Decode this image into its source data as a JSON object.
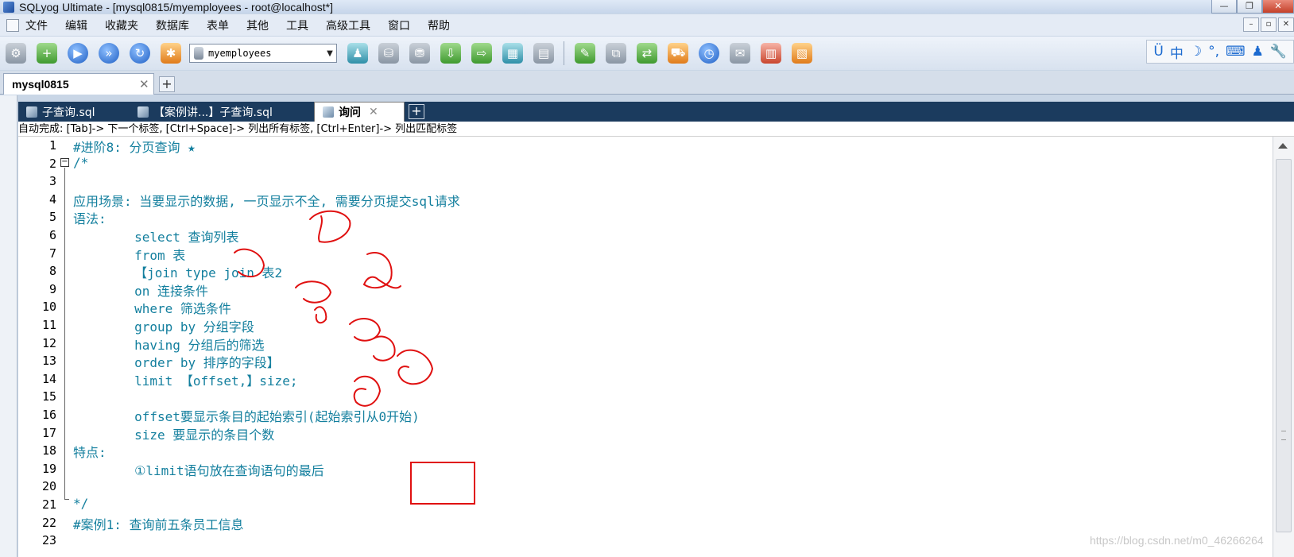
{
  "window": {
    "title": "SQLyog Ultimate - [mysql0815/myemployees - root@localhost*]",
    "buttons": [
      "—",
      "❐",
      "✕"
    ]
  },
  "menubar": {
    "items": [
      "文件",
      "编辑",
      "收藏夹",
      "数据库",
      "表单",
      "其他",
      "工具",
      "高级工具",
      "窗口",
      "帮助"
    ],
    "mdi_buttons": [
      "–",
      "▫",
      "✕"
    ]
  },
  "toolbar": {
    "database_selector": "myemployees",
    "icons": [
      "connect-icon",
      "new-connection-icon",
      "execute-query-icon",
      "execute-all-icon",
      "refresh-icon",
      "object-browser-icon",
      "user-manager-icon",
      "backup-icon",
      "restore-icon",
      "import-icon",
      "export-icon",
      "table-data-icon",
      "schema-designer-icon",
      "query-builder-icon",
      "copy-database-icon",
      "sync-icon",
      "migration-icon",
      "scheduler-icon",
      "notifications-icon",
      "sql-formatter-icon",
      "history-icon"
    ],
    "ime_items": [
      "Ü",
      "中",
      "☽",
      "°,",
      "⌨",
      "♟",
      "🔧"
    ]
  },
  "connection_tab": {
    "label": "mysql0815",
    "close": "✕",
    "add": "+"
  },
  "editor_tabs": [
    {
      "label": "子查询.sql",
      "active": false
    },
    {
      "label": "【案例讲...】子查询.sql",
      "active": false
    },
    {
      "label": "询问",
      "active": true
    }
  ],
  "editor_tab_close": "✕",
  "editor_tab_add": "+",
  "autocomplete_hint": "自动完成: [Tab]-> 下一个标签, [Ctrl+Space]-> 列出所有标签, [Ctrl+Enter]-> 列出匹配标签",
  "code_lines": [
    {
      "n": "1",
      "text": "#进阶8: 分页查询 ★"
    },
    {
      "n": "2",
      "text": "/*"
    },
    {
      "n": "3",
      "text": ""
    },
    {
      "n": "4",
      "text": "应用场景: 当要显示的数据, 一页显示不全, 需要分页提交sql请求"
    },
    {
      "n": "5",
      "text": "语法:"
    },
    {
      "n": "6",
      "text": "        select 查询列表"
    },
    {
      "n": "7",
      "text": "        from 表"
    },
    {
      "n": "8",
      "text": "        【join type join 表2"
    },
    {
      "n": "9",
      "text": "        on 连接条件"
    },
    {
      "n": "10",
      "text": "        where 筛选条件"
    },
    {
      "n": "11",
      "text": "        group by 分组字段"
    },
    {
      "n": "12",
      "text": "        having 分组后的筛选"
    },
    {
      "n": "13",
      "text": "        order by 排序的字段】"
    },
    {
      "n": "14",
      "text": "        limit 【offset,】size;"
    },
    {
      "n": "15",
      "text": ""
    },
    {
      "n": "16",
      "text": "        offset要显示条目的起始索引(起始索引从0开始)"
    },
    {
      "n": "17",
      "text": "        size 要显示的条目个数"
    },
    {
      "n": "18",
      "text": "特点:"
    },
    {
      "n": "19",
      "text": "        ①limit语句放在查询语句的最后"
    },
    {
      "n": "20",
      "text": ""
    },
    {
      "n": "21",
      "text": "*/"
    },
    {
      "n": "22",
      "text": "#案例1: 查询前五条员工信息"
    },
    {
      "n": "23",
      "text": ""
    }
  ],
  "handwritten_annotations": [
    "7",
    "1",
    "2",
    "3",
    "4",
    "5",
    "6",
    "8",
    "9"
  ],
  "watermark": "https://blog.csdn.net/m0_46266264",
  "colors": {
    "code_text": "#137f9e",
    "annotation_red": "#e01010",
    "editor_tab_bar": "#1b3b5e"
  }
}
